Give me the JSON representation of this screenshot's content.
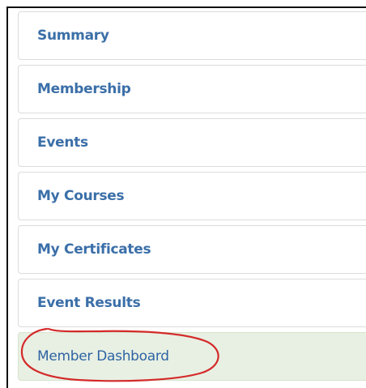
{
  "menu": {
    "items": [
      {
        "label": "Summary"
      },
      {
        "label": "Membership"
      },
      {
        "label": "Events"
      },
      {
        "label": "My Courses"
      },
      {
        "label": "My Certificates"
      },
      {
        "label": "Event Results"
      },
      {
        "label": "Member Dashboard",
        "active": true
      }
    ]
  },
  "colors": {
    "link": "#3b6fa8",
    "active_background": "#e8f0e3",
    "annotation": "#d42a2a"
  }
}
